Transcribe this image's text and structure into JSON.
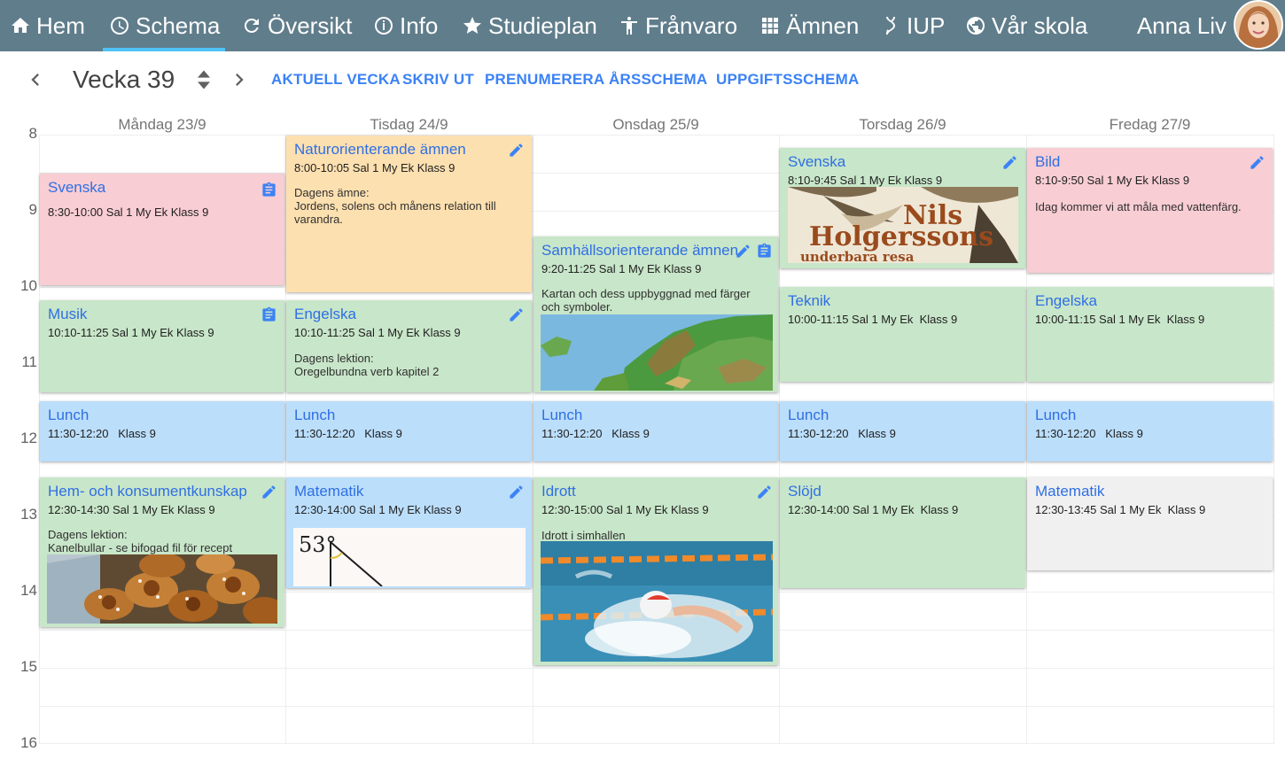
{
  "nav": {
    "items": [
      {
        "label": "Hem",
        "icon": "home-icon"
      },
      {
        "label": "Schema",
        "icon": "clock-icon"
      },
      {
        "label": "Översikt",
        "icon": "refresh-icon"
      },
      {
        "label": "Info",
        "icon": "info-icon"
      },
      {
        "label": "Studieplan",
        "icon": "star-icon"
      },
      {
        "label": "Frånvaro",
        "icon": "person-icon"
      },
      {
        "label": "Ämnen",
        "icon": "grid-icon"
      },
      {
        "label": "IUP",
        "icon": "dna-icon"
      },
      {
        "label": "Vår skola",
        "icon": "globe-icon"
      }
    ],
    "active": "Schema",
    "user_name": "Anna Liv"
  },
  "toolbar": {
    "week_label": "Vecka 39",
    "links": [
      "AKTUELL VECKA",
      "SKRIV UT",
      "PRENUMERERA",
      "ÅRSSCHEMA",
      "UPPGIFTSSCHEMA"
    ]
  },
  "schedule": {
    "days": [
      "Måndag 23/9",
      "Tisdag 24/9",
      "Onsdag 25/9",
      "Torsdag 26/9",
      "Fredag 27/9"
    ],
    "hours": [
      "8",
      "9",
      "10",
      "11",
      "12",
      "13",
      "14",
      "15",
      "16"
    ],
    "events": [
      {
        "title": "Svenska",
        "time": "8:30-10:00 Sal 1 My Ek  Klass 9",
        "color": "#f8cdd3",
        "icon": "clipboard-icon"
      },
      {
        "title": "Musik",
        "time": "10:10-11:25 Sal 1 My Ek  Klass 9",
        "color": "#c8e6c9",
        "icon": "clipboard-icon"
      },
      {
        "title": "Lunch",
        "time": "11:30-12:20   Klass 9",
        "color": "#bbdefb"
      },
      {
        "title": "Hem- och konsumentkunskap",
        "time": "12:30-14:30 Sal 1 My Ek Klass 9",
        "desc1": "Dagens lektion:",
        "desc2": "Kanelbullar - se bifogad fil för recept",
        "color": "#c8e6c9",
        "icon": "pencil-icon"
      },
      {
        "title": "Naturorienterande ämnen",
        "time": "8:00-10:05 Sal 1 My Ek Klass 9",
        "desc1": "Dagens ämne:",
        "desc2": "Jordens, solens och månens relation till varandra.",
        "color": "#fde0b0",
        "icon": "pencil-icon"
      },
      {
        "title": "Engelska",
        "time": "10:10-11:25 Sal 1 My Ek Klass 9",
        "desc1": "Dagens lektion:",
        "desc2": "Oregelbundna verb kapitel 2",
        "color": "#c8e6c9",
        "icon": "pencil-icon"
      },
      {
        "title": "Lunch",
        "time": "11:30-12:20   Klass 9",
        "color": "#bbdefb"
      },
      {
        "title": "Matematik",
        "time": "12:30-14:00 Sal 1 My Ek Klass 9",
        "color": "#bbdefb",
        "icon": "pencil-icon",
        "angle_label": "53°"
      },
      {
        "title": "Samhällsorienterande ämnen",
        "time": "9:20-11:25 Sal 1 My Ek Klass 9",
        "desc1": "Kartan och dess uppbyggnad med färger och symboler.",
        "color": "#c8e6c9",
        "icon": "pencil-icon",
        "icon2": "clipboard-icon"
      },
      {
        "title": "Lunch",
        "time": "11:30-12:20   Klass 9",
        "color": "#bbdefb"
      },
      {
        "title": "Idrott",
        "time": "12:30-15:00 Sal 1 My Ek Klass 9",
        "desc1": "Idrott i simhallen",
        "color": "#c8e6c9",
        "icon": "pencil-icon"
      },
      {
        "title": "Svenska",
        "time": "8:10-9:45 Sal 1 My Ek Klass 9",
        "color": "#c8e6c9",
        "icon": "pencil-icon",
        "book_title_1": "Nils",
        "book_title_2": "Holgerssons",
        "book_title_3": "underbara resa"
      },
      {
        "title": "Teknik",
        "time": "10:00-11:15 Sal 1 My Ek  Klass 9",
        "color": "#c8e6c9"
      },
      {
        "title": "Lunch",
        "time": "11:30-12:20   Klass 9",
        "color": "#bbdefb"
      },
      {
        "title": "Slöjd",
        "time": "12:30-14:00 Sal 1 My Ek  Klass 9",
        "color": "#c8e6c9"
      },
      {
        "title": "Bild",
        "time": "8:10-9:50 Sal 1 My Ek Klass 9",
        "desc1": "Idag kommer vi att måla med vattenfärg.",
        "color": "#f8cdd3",
        "icon": "pencil-icon"
      },
      {
        "title": "Engelska",
        "time": "10:00-11:15 Sal 1 My Ek  Klass 9",
        "color": "#c8e6c9"
      },
      {
        "title": "Lunch",
        "time": "11:30-12:20   Klass 9",
        "color": "#bbdefb"
      },
      {
        "title": "Matematik",
        "time": "12:30-13:45 Sal 1 My Ek  Klass 9",
        "color": "#f0f0f0"
      }
    ]
  }
}
